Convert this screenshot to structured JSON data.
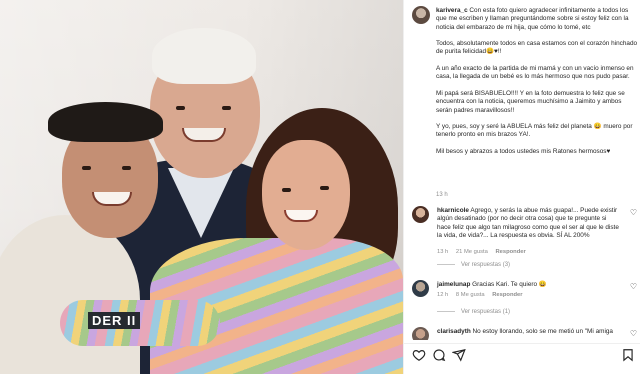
{
  "photo": {
    "shirt_print": "DER II"
  },
  "post": {
    "username": "karivera_c",
    "caption": "Con esta foto quiero agradecer infinitamente a todos los que me escriben y llaman preguntándome sobre si estoy feliz con la noticia del embarazo de mi hija, que cómo lo tomé, etc\n\nTodos, absolutamente todos en casa estamos con el corazón hinchado de purita felicidad😄♥!!\n\nA un año exacto de la partida de mi mamá y con un vacío inmenso en casa, la llegada de un bebé es lo más hermoso que nos pudo pasar.\n\nMi papá será BISABUELO!!!! Y en la foto demuestra lo feliz que se encuentra con la noticia, queremos muchísimo a Jaimito y ambos serán padres maravillosos!!\n\nY yo, pues, soy y seré la ABUELA más feliz del planeta 😄 muero por tenerlo pronto en mis brazos YA!.\n\nMil besos y abrazos a todos ustedes mis Ratones hermosos♥",
    "time": "13 h"
  },
  "comments": [
    {
      "username": "hkarnicole",
      "text": "Agrego, y serás la abue más guapa!... Puede existir algún desatinado (por no decir otra cosa) que te pregunte si hace feliz que algo tan milagroso como que el ser al que le diste la vida, de vida?... La respuesta es obvia. SÍ AL 200%",
      "time": "13 h",
      "likes": "21 Me gusta",
      "reply": "Responder",
      "replies": "Ver respuestas (3)"
    },
    {
      "username": "jaimelunap",
      "text": "Gracias Kari. Te quiero 😄",
      "time": "12 h",
      "likes": "8 Me gusta",
      "reply": "Responder",
      "replies": "Ver respuestas (1)"
    },
    {
      "username": "clarisadyth",
      "text": "No estoy llorando, solo se me metió un \"Mi amiga"
    }
  ],
  "actions": [
    "heart-icon",
    "comment-icon",
    "share-icon",
    "bookmark-icon"
  ],
  "colors": {
    "text": "#262626",
    "muted": "#8e8e8e",
    "divider": "#efefef"
  }
}
